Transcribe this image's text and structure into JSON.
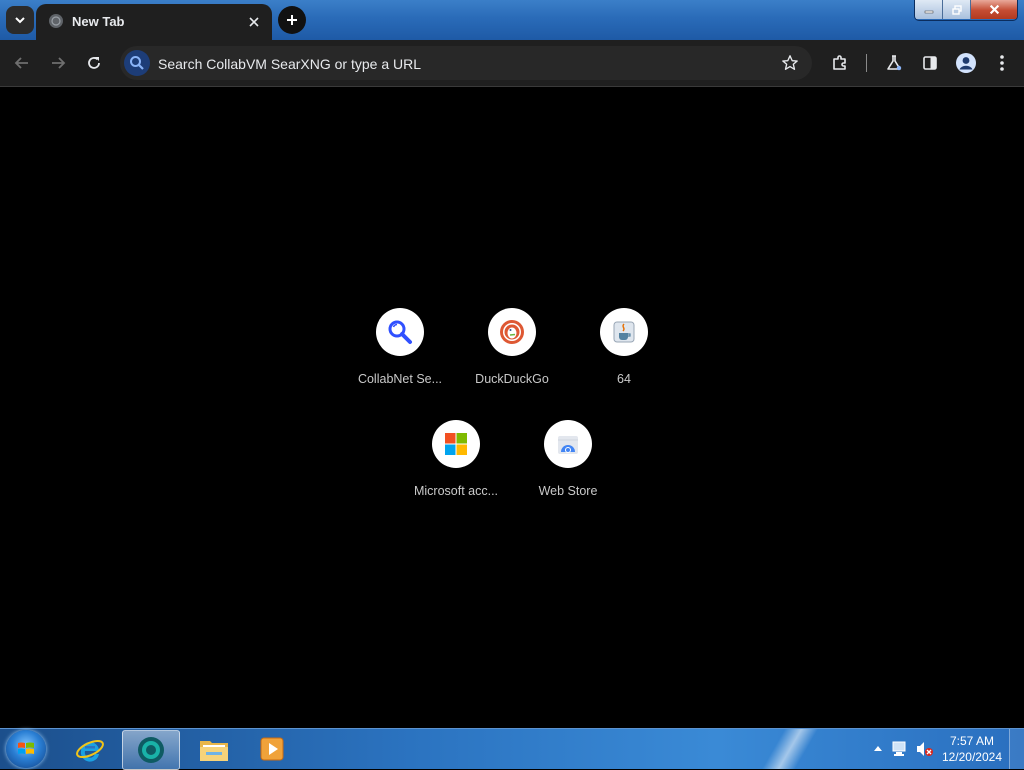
{
  "tab": {
    "title": "New Tab"
  },
  "omnibox": {
    "placeholder": "Search CollabVM SearXNG or type a URL"
  },
  "shortcuts": [
    {
      "label": "CollabNet Se...",
      "icon": "searxng-icon"
    },
    {
      "label": "DuckDuckGo",
      "icon": "duckduckgo-icon"
    },
    {
      "label": "64",
      "icon": "java-icon"
    },
    {
      "label": "Microsoft acc...",
      "icon": "microsoft-icon"
    },
    {
      "label": "Web Store",
      "icon": "chrome-web-store-icon"
    }
  ],
  "taskbar": {
    "apps": [
      "internet-explorer-icon",
      "chrome-icon",
      "file-explorer-icon",
      "media-player-icon"
    ],
    "clock": {
      "time": "7:57 AM",
      "date": "12/20/2024"
    }
  },
  "colors": {
    "page_bg": "#000000",
    "toolbar_bg": "#1f1f1f",
    "omnibox_bg": "#282828",
    "accent": "#2b6fc0"
  }
}
